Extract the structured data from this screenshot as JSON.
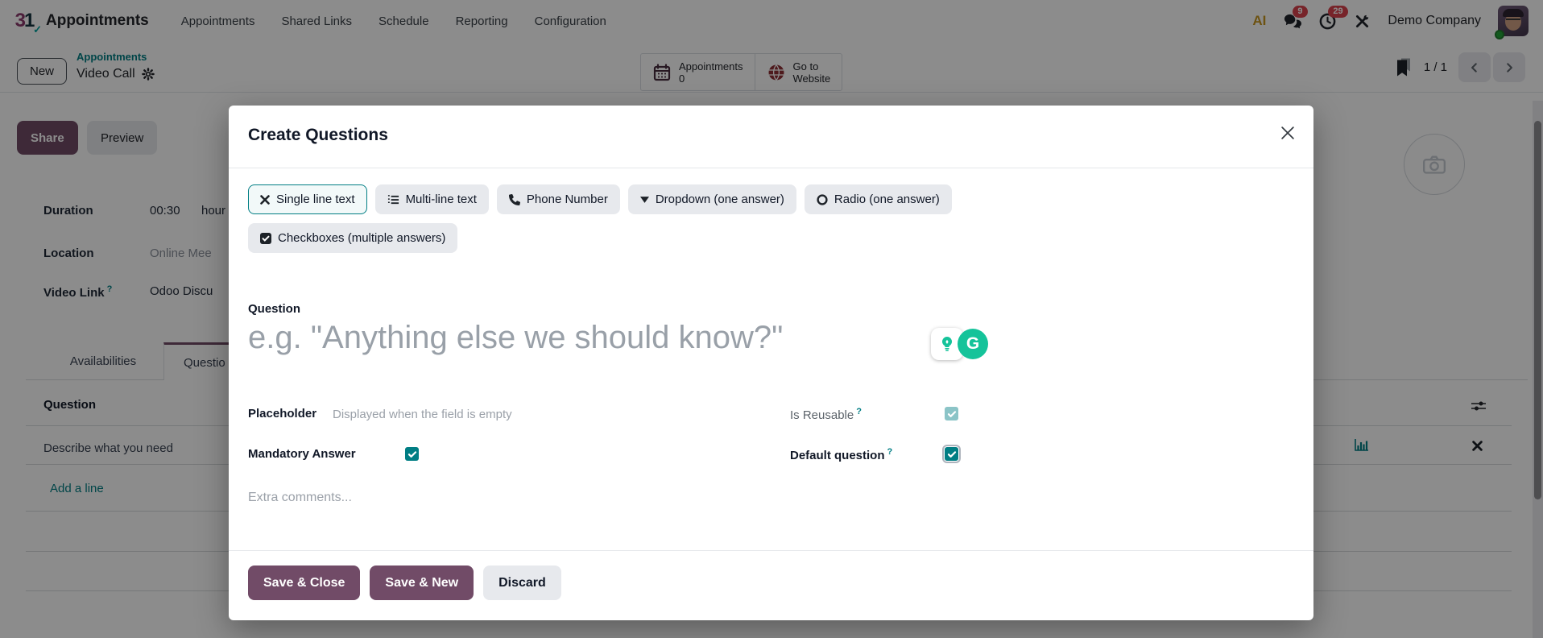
{
  "navbar": {
    "app_name": "Appointments",
    "menu_items": [
      "Appointments",
      "Shared Links",
      "Schedule",
      "Reporting",
      "Configuration"
    ],
    "ai_label": "AI",
    "messages_badge": "9",
    "activities_badge": "29",
    "company_name": "Demo Company"
  },
  "control_panel": {
    "new_button_label": "New",
    "breadcrumb": {
      "parent": "Appointments",
      "current": "Video Call"
    },
    "stat_buttons": [
      {
        "icon": "calendar-icon",
        "line1": "Appointments",
        "line2": "0"
      },
      {
        "icon": "globe-icon",
        "line1": "Go to",
        "line2": "Website"
      }
    ],
    "pager_value": "1 / 1"
  },
  "page": {
    "share_button_label": "Share",
    "preview_button_label": "Preview",
    "fields": {
      "duration": {
        "label": "Duration",
        "value": "00:30",
        "unit": "hour"
      },
      "location": {
        "label": "Location",
        "value": "Online Mee"
      },
      "video_link": {
        "label": "Video Link",
        "help": "?",
        "value": "Odoo Discu"
      }
    },
    "tabs": [
      {
        "label": "Availabilities",
        "active": false
      },
      {
        "label": "Questio",
        "active": true
      }
    ],
    "questions_table": {
      "header": "Question",
      "rows": [
        "Describe what you need"
      ],
      "add_line_label": "Add a line"
    }
  },
  "modal": {
    "title": "Create Questions",
    "type_buttons": [
      {
        "label": "Single line text",
        "icon": "x-mark-icon",
        "active": true
      },
      {
        "label": "Multi-line text",
        "icon": "ordered-list-icon",
        "active": false
      },
      {
        "label": "Phone Number",
        "icon": "phone-icon",
        "active": false
      },
      {
        "label": "Dropdown (one answer)",
        "icon": "caret-down-icon",
        "active": false
      },
      {
        "label": "Radio (one answer)",
        "icon": "radio-circle-icon",
        "active": false
      },
      {
        "label": "Checkboxes (multiple answers)",
        "icon": "checkbox-icon",
        "active": false
      }
    ],
    "question_label": "Question",
    "question_placeholder": "e.g. \"Anything else we should know?\"",
    "placeholder_label": "Placeholder",
    "placeholder_hint": "Displayed when the field is empty",
    "is_reusable_label": "Is Reusable",
    "is_reusable_help": "?",
    "is_reusable_checked": true,
    "mandatory_label": "Mandatory Answer",
    "mandatory_checked": true,
    "default_question_label": "Default question",
    "default_question_help": "?",
    "default_question_checked": true,
    "comments_placeholder": "Extra comments...",
    "grammarly_letter": "G",
    "footer": {
      "save_close": "Save & Close",
      "save_new": "Save & New",
      "discard": "Discard"
    }
  },
  "colors": {
    "accent_purple": "#714B67",
    "accent_teal": "#017E84",
    "badge_red": "#D9434E",
    "grammarly_green": "#15C39A"
  }
}
